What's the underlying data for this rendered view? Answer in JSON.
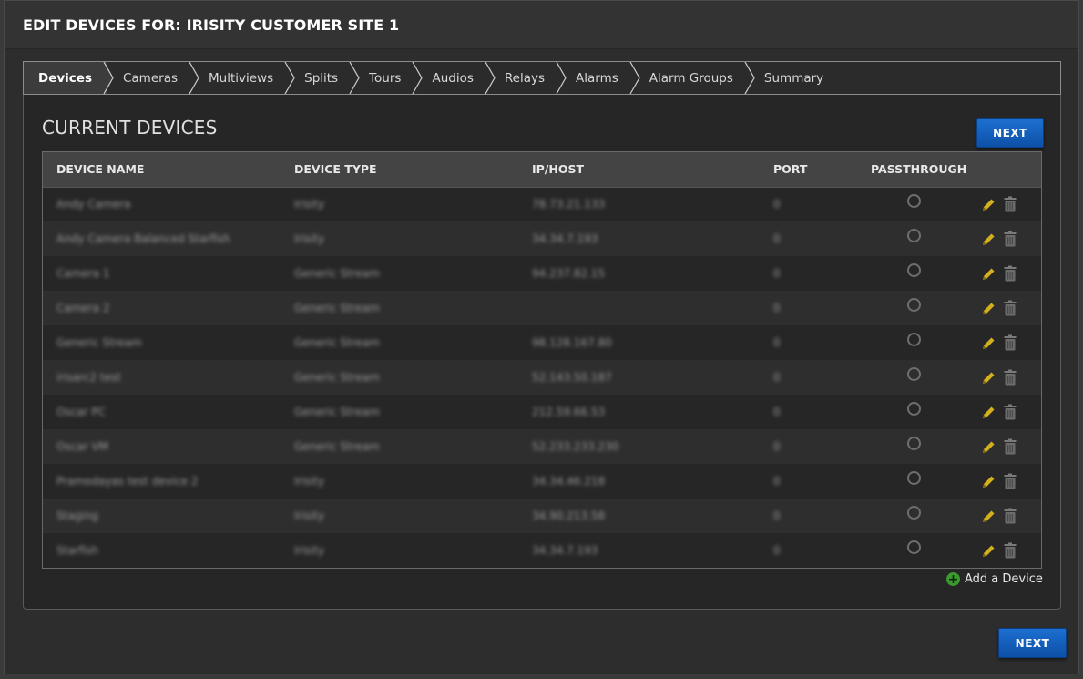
{
  "header": {
    "title": "EDIT DEVICES FOR: IRISITY CUSTOMER SITE 1"
  },
  "steps": [
    "Devices",
    "Cameras",
    "Multiviews",
    "Splits",
    "Tours",
    "Audios",
    "Relays",
    "Alarms",
    "Alarm Groups",
    "Summary"
  ],
  "active_step": "Devices",
  "section": {
    "title": "CURRENT DEVICES",
    "next_label": "NEXT"
  },
  "table": {
    "columns": [
      "DEVICE NAME",
      "DEVICE TYPE",
      "IP/HOST",
      "PORT",
      "PASSTHROUGH"
    ],
    "rows": [
      {
        "name": "Andy Camera",
        "type": "Irisity",
        "ip": "78.73.21.133",
        "port": "0"
      },
      {
        "name": "Andy Camera Balanced Starfish",
        "type": "Irisity",
        "ip": "34.34.7.193",
        "port": "0"
      },
      {
        "name": "Camera 1",
        "type": "Generic Stream",
        "ip": "94.237.82.15",
        "port": "0"
      },
      {
        "name": "Camera 2",
        "type": "Generic Stream",
        "ip": "",
        "port": "0"
      },
      {
        "name": "Generic Stream",
        "type": "Generic Stream",
        "ip": "98.128.167.80",
        "port": "0"
      },
      {
        "name": "irisarc2 test",
        "type": "Generic Stream",
        "ip": "52.143.50.187",
        "port": "0"
      },
      {
        "name": "Oscar PC",
        "type": "Generic Stream",
        "ip": "212.59.66.53",
        "port": "0"
      },
      {
        "name": "Oscar VM",
        "type": "Generic Stream",
        "ip": "52.233.233.230",
        "port": "0"
      },
      {
        "name": "Pramodayas test device 2",
        "type": "Irisity",
        "ip": "34.34.46.218",
        "port": "0"
      },
      {
        "name": "Staging",
        "type": "Irisity",
        "ip": "34.90.213.58",
        "port": "0"
      },
      {
        "name": "Starfish",
        "type": "Irisity",
        "ip": "34.34.7.193",
        "port": "0"
      }
    ]
  },
  "add_device_label": "Add a Device",
  "footer": {
    "next_label": "NEXT"
  },
  "colors": {
    "accent": "#1565c0",
    "edit_icon": "#d4b021",
    "add_icon": "#3b9a2e"
  }
}
